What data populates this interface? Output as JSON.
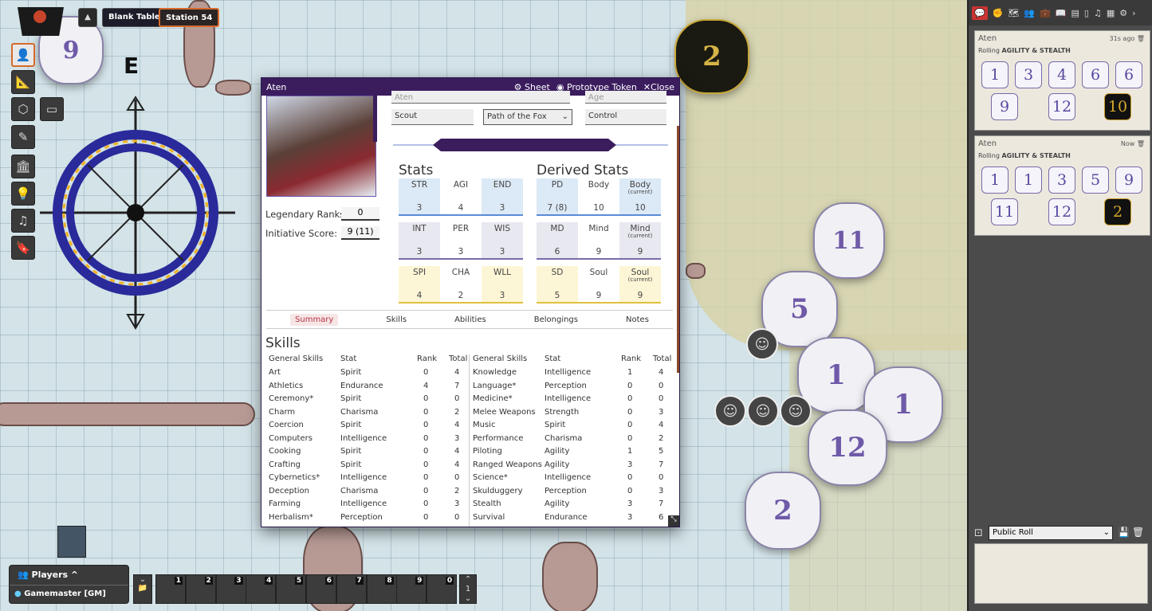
{
  "top": {
    "table_name": "Blank Table",
    "page_name": "Station 54"
  },
  "map": {
    "compass_label": "E"
  },
  "toolbar": [
    "select-icon",
    "ruler-icon",
    "shapes-icon",
    "pencil-icon",
    "bank-icon",
    "lightbulb-icon",
    "music-icon",
    "bookmark-icon"
  ],
  "sheet": {
    "title": "Aten",
    "actions": {
      "sheet": "Sheet",
      "token": "Prototype Token",
      "close": "Close"
    },
    "name_value": "Aten",
    "age_placeholder": "Age",
    "role": "Scout",
    "path": "Path of the Fox",
    "control": "Control",
    "legendary_label": "Legendary Ranks:",
    "legendary_value": "0",
    "initiative_label": "Initiative Score:",
    "initiative_value": "9 (11)",
    "stats_heading": "Stats",
    "derived_heading": "Derived Stats",
    "stats": [
      {
        "n": "STR",
        "v": "3"
      },
      {
        "n": "AGI",
        "v": "4"
      },
      {
        "n": "END",
        "v": "3"
      },
      {
        "n": "INT",
        "v": "3"
      },
      {
        "n": "PER",
        "v": "3"
      },
      {
        "n": "WIS",
        "v": "3"
      },
      {
        "n": "SPI",
        "v": "4"
      },
      {
        "n": "CHA",
        "v": "2"
      },
      {
        "n": "WLL",
        "v": "3"
      }
    ],
    "derived": [
      {
        "n": "PD",
        "s": "",
        "v": "7 (8)"
      },
      {
        "n": "Body",
        "s": "",
        "v": "10"
      },
      {
        "n": "Body",
        "s": "(current)",
        "v": "10"
      },
      {
        "n": "MD",
        "s": "",
        "v": "6"
      },
      {
        "n": "Mind",
        "s": "",
        "v": "9"
      },
      {
        "n": "Mind",
        "s": "(current)",
        "v": "9"
      },
      {
        "n": "SD",
        "s": "",
        "v": "5"
      },
      {
        "n": "Soul",
        "s": "",
        "v": "9"
      },
      {
        "n": "Soul",
        "s": "(current)",
        "v": "9"
      }
    ],
    "tabs": [
      "Summary",
      "Skills",
      "Abilities",
      "Belongings",
      "Notes"
    ],
    "skills_heading": "Skills",
    "skills_headers": {
      "general": "General Skills",
      "stat": "Stat",
      "rank": "Rank",
      "total": "Total"
    },
    "skills_left": [
      [
        "Art",
        "Spirit",
        "0",
        "4"
      ],
      [
        "Athletics",
        "Endurance",
        "4",
        "7"
      ],
      [
        "Ceremony*",
        "Spirit",
        "0",
        "0"
      ],
      [
        "Charm",
        "Charisma",
        "0",
        "2"
      ],
      [
        "Coercion",
        "Spirit",
        "0",
        "4"
      ],
      [
        "Computers",
        "Intelligence",
        "0",
        "3"
      ],
      [
        "Cooking",
        "Spirit",
        "0",
        "4"
      ],
      [
        "Crafting",
        "Spirit",
        "0",
        "4"
      ],
      [
        "Cybernetics*",
        "Intelligence",
        "0",
        "0"
      ],
      [
        "Deception",
        "Charisma",
        "0",
        "2"
      ],
      [
        "Farming",
        "Intelligence",
        "0",
        "3"
      ],
      [
        "Herbalism*",
        "Perception",
        "0",
        "0"
      ]
    ],
    "skills_right": [
      [
        "Knowledge",
        "Intelligence",
        "1",
        "4"
      ],
      [
        "Language*",
        "Perception",
        "0",
        "0"
      ],
      [
        "Medicine*",
        "Intelligence",
        "0",
        "0"
      ],
      [
        "Melee Weapons",
        "Strength",
        "0",
        "3"
      ],
      [
        "Music",
        "Spirit",
        "0",
        "4"
      ],
      [
        "Performance",
        "Charisma",
        "0",
        "2"
      ],
      [
        "Piloting",
        "Agility",
        "1",
        "5"
      ],
      [
        "Ranged Weapons",
        "Agility",
        "3",
        "7"
      ],
      [
        "Science*",
        "Intelligence",
        "0",
        "0"
      ],
      [
        "Skulduggery",
        "Perception",
        "0",
        "3"
      ],
      [
        "Stealth",
        "Agility",
        "3",
        "7"
      ],
      [
        "Survival",
        "Endurance",
        "3",
        "6"
      ]
    ]
  },
  "chat": {
    "messages": [
      {
        "who": "Aten",
        "time": "31s ago",
        "roll_prefix": "Rolling ",
        "roll_bold": "AGILITY & STEALTH",
        "dice": [
          "1",
          "3",
          "4",
          "6",
          "6",
          "9",
          "12"
        ],
        "special": "10"
      },
      {
        "who": "Aten",
        "time": "Now",
        "roll_prefix": "Rolling ",
        "roll_bold": "AGILITY & STEALTH",
        "dice": [
          "1",
          "1",
          "3",
          "5",
          "9",
          "11",
          "12"
        ],
        "special": "2"
      }
    ],
    "roll_mode": "Public Roll"
  },
  "players": {
    "title": "Players",
    "gm": "Gamemaster [GM]"
  },
  "macrobar": [
    "1",
    "2",
    "3",
    "4",
    "5",
    "6",
    "7",
    "8",
    "9",
    "0"
  ],
  "map_dice": [
    "9",
    "2",
    "11",
    "5",
    "1",
    "1",
    "12",
    "2"
  ],
  "colors": {
    "sheet_header": "#3b1d5e",
    "accent": "#d66a2b",
    "die_purple": "#5b48a0",
    "gold": "#d7a92c"
  }
}
